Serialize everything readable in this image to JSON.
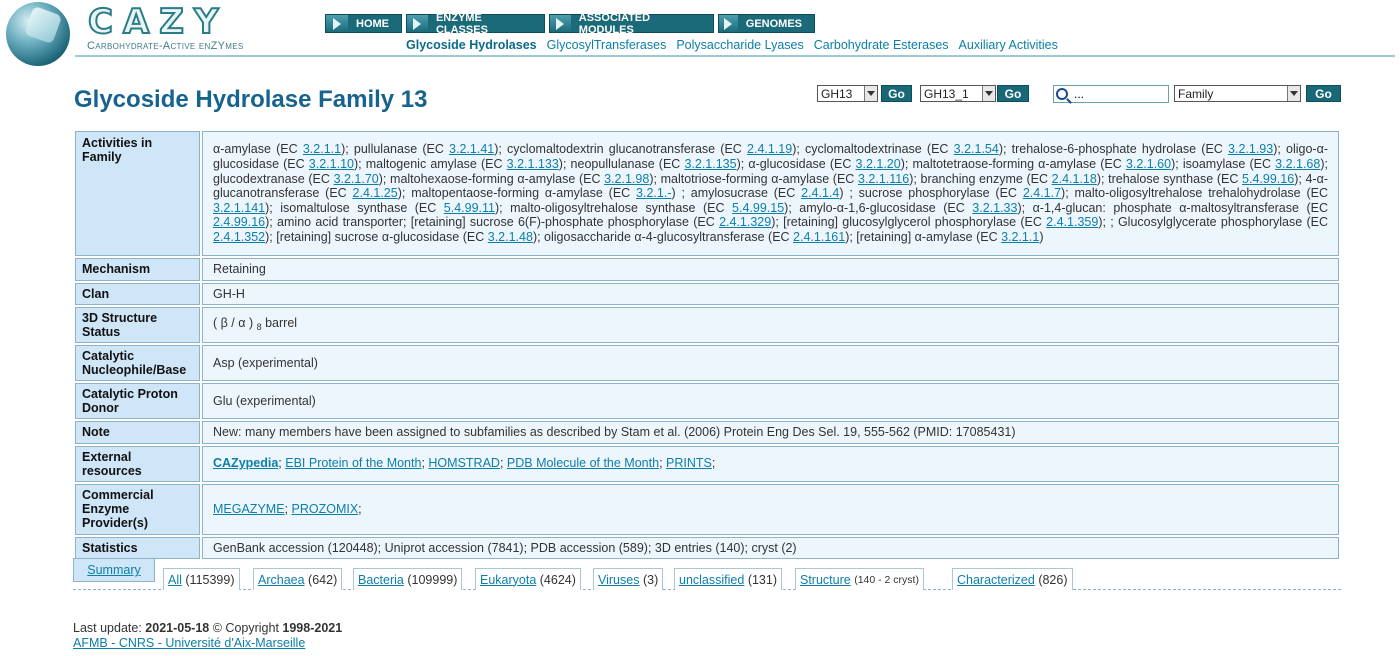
{
  "header": {
    "logo_text": "CAZY",
    "logo_subtitle": "Carbohydrate-Active enZYmes",
    "nav": [
      "HOME",
      "ENZYME CLASSES",
      "ASSOCIATED MODULES",
      "GENOMES"
    ],
    "subnav": [
      "Glycoside Hydrolases",
      "GlycosylTransferases",
      "Polysaccharide Lyases",
      "Carbohydrate Esterases",
      "Auxiliary Activities"
    ]
  },
  "page_title": "Glycoside Hydrolase Family 13",
  "controls": {
    "family_select": "GH13",
    "subfamily_select": "GH13_1",
    "go": "Go",
    "search_value": "...",
    "search_type": "Family"
  },
  "rows": {
    "activities": {
      "label": "Activities in Family",
      "parts": [
        {
          "t": "α-amylase (EC "
        },
        {
          "l": "3.2.1.1"
        },
        {
          "t": "); pullulanase (EC "
        },
        {
          "l": "3.2.1.41"
        },
        {
          "t": "); cyclomaltodextrin glucanotransferase (EC "
        },
        {
          "l": "2.4.1.19"
        },
        {
          "t": "); cyclomaltodextrinase (EC "
        },
        {
          "l": "3.2.1.54"
        },
        {
          "t": "); trehalose-6-phosphate hydrolase (EC "
        },
        {
          "l": "3.2.1.93"
        },
        {
          "t": "); oligo-α-glucosidase (EC "
        },
        {
          "l": "3.2.1.10"
        },
        {
          "t": "); maltogenic amylase (EC "
        },
        {
          "l": "3.2.1.133"
        },
        {
          "t": "); neopullulanase (EC "
        },
        {
          "l": "3.2.1.135"
        },
        {
          "t": "); α-glucosidase (EC "
        },
        {
          "l": "3.2.1.20"
        },
        {
          "t": "); maltotetraose-forming α-amylase (EC "
        },
        {
          "l": "3.2.1.60"
        },
        {
          "t": "); isoamylase (EC "
        },
        {
          "l": "3.2.1.68"
        },
        {
          "t": "); glucodextranase (EC "
        },
        {
          "l": "3.2.1.70"
        },
        {
          "t": "); maltohexaose-forming α-amylase (EC "
        },
        {
          "l": "3.2.1.98"
        },
        {
          "t": "); maltotriose-forming α-amylase (EC "
        },
        {
          "l": "3.2.1.116"
        },
        {
          "t": "); branching enzyme (EC "
        },
        {
          "l": "2.4.1.18"
        },
        {
          "t": "); trehalose synthase (EC "
        },
        {
          "l": "5.4.99.16"
        },
        {
          "t": "); 4-α-glucanotransferase (EC "
        },
        {
          "l": "2.4.1.25"
        },
        {
          "t": "); maltopentaose-forming α-amylase (EC "
        },
        {
          "l": "3.2.1.-"
        },
        {
          "t": ") ; amylosucrase (EC "
        },
        {
          "l": "2.4.1.4"
        },
        {
          "t": ") ; sucrose phosphorylase (EC "
        },
        {
          "l": "2.4.1.7"
        },
        {
          "t": "); malto-oligosyltrehalose trehalohydrolase (EC "
        },
        {
          "l": "3.2.1.141"
        },
        {
          "t": "); isomaltulose synthase (EC "
        },
        {
          "l": "5.4.99.11"
        },
        {
          "t": "); malto-oligosyltrehalose synthase (EC "
        },
        {
          "l": "5.4.99.15"
        },
        {
          "t": "); amylo-α-1,6-glucosidase (EC "
        },
        {
          "l": "3.2.1.33"
        },
        {
          "t": "); α-1,4-glucan: phosphate α-maltosyltransferase (EC "
        },
        {
          "l": "2.4.99.16"
        },
        {
          "t": "); amino acid transporter; [retaining] sucrose 6(F)-phosphate phosphorylase (EC "
        },
        {
          "l": "2.4.1.329"
        },
        {
          "t": "); [retaining] glucosylglycerol phosphorylase (EC "
        },
        {
          "l": "2.4.1.359"
        },
        {
          "t": "); ; Glucosylglycerate phosphorylase (EC "
        },
        {
          "l": "2.4.1.352"
        },
        {
          "t": "); [retaining] sucrose α-glucosidase (EC "
        },
        {
          "l": "3.2.1.48"
        },
        {
          "t": "); oligosaccharide α-4-glucosyltransferase (EC "
        },
        {
          "l": "2.4.1.161"
        },
        {
          "t": "); [retaining] α-amylase (EC "
        },
        {
          "l": "3.2.1.1"
        },
        {
          "t": ")"
        }
      ]
    },
    "mechanism": {
      "label": "Mechanism",
      "value": "Retaining"
    },
    "clan": {
      "label": "Clan",
      "value": "GH-H"
    },
    "structure": {
      "label": "3D Structure Status",
      "pre": "( β / α )",
      "sub": "8",
      "post": "barrel"
    },
    "nucleophile": {
      "label": "Catalytic Nucleophile/Base",
      "value": "Asp (experimental)"
    },
    "proton_donor": {
      "label": "Catalytic Proton Donor",
      "value": "Glu (experimental)"
    },
    "note": {
      "label": "Note",
      "value": "New: many members have been assigned to subfamilies as described by Stam et al. (2006) Protein Eng Des Sel. 19, 555-562 (PMID: 17085431)"
    },
    "external": {
      "label": "External resources",
      "cazypedia": "CAZypedia",
      "links": [
        "EBI Protein of the Month",
        "HOMSTRAD",
        "PDB Molecule of the Month",
        "PRINTS"
      ]
    },
    "commercial": {
      "label": "Commercial Enzyme Provider(s)",
      "links": [
        "MEGAZYME",
        "PROZOMIX"
      ]
    },
    "statistics": {
      "label": "Statistics",
      "value": "GenBank accession (120448); Uniprot accession (7841); PDB accession (589); 3D entries (140); cryst (2)"
    }
  },
  "tabs": {
    "summary": "Summary",
    "items": [
      {
        "link": "All",
        "count": "(115399)"
      },
      {
        "link": "Archaea",
        "count": "(642)"
      },
      {
        "link": "Bacteria",
        "count": "(109999)"
      },
      {
        "link": "Eukaryota",
        "count": "(4624)"
      },
      {
        "link": "Viruses",
        "count": "(3)"
      },
      {
        "link": "unclassified",
        "count": "(131)"
      },
      {
        "link": "Structure",
        "count": "(140 - 2 cryst)"
      },
      {
        "link": "Characterized",
        "count": "(826)"
      }
    ]
  },
  "footer": {
    "last_update_label": "Last update:",
    "date": "2021-05-18",
    "copyright": "© Copyright",
    "years": "1998-2021",
    "org_link": "AFMB - CNRS - Université d'Aix-Marseille"
  },
  "colors": {
    "title": "#17638f",
    "link": "#0c7fa8",
    "nav": "#1a6a79",
    "label_bg": "#cfe6f8",
    "value_bg": "#eef6fd"
  }
}
